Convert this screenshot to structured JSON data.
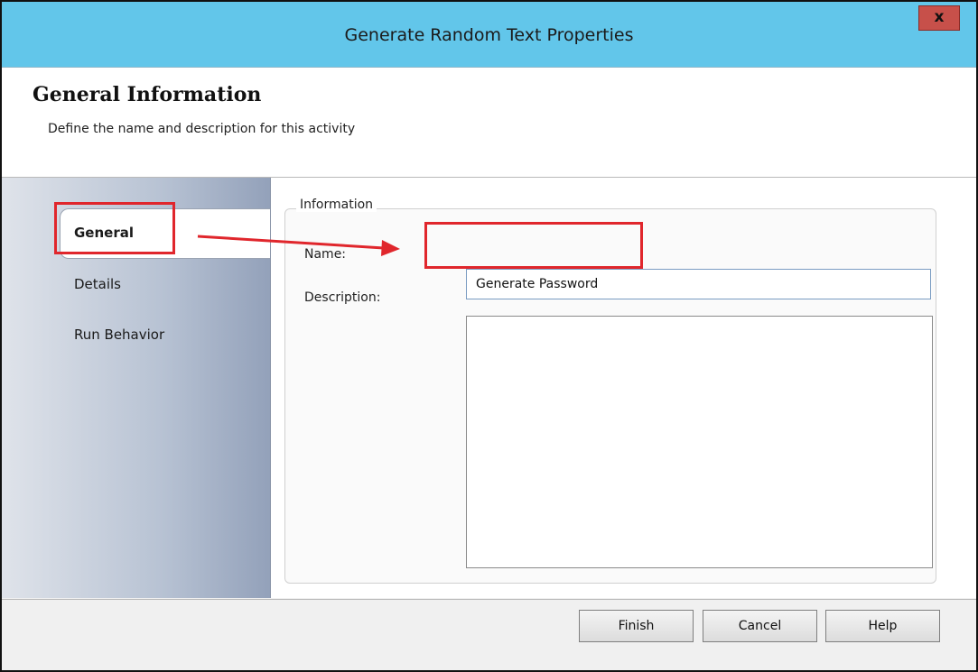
{
  "window": {
    "title": "Generate Random Text Properties",
    "close_label": "x",
    "titlebar_color": "#62c6ea",
    "close_color": "#c7504a"
  },
  "header": {
    "title": "General Information",
    "subtitle": "Define the name and description for this activity"
  },
  "nav": {
    "items": [
      {
        "label": "General",
        "active": true
      },
      {
        "label": "Details",
        "active": false
      },
      {
        "label": "Run Behavior",
        "active": false
      }
    ]
  },
  "form": {
    "group_label": "Information",
    "name_label": "Name:",
    "name_value": "Generate Password",
    "description_label": "Description:",
    "description_value": ""
  },
  "footer": {
    "finish_label": "Finish",
    "cancel_label": "Cancel",
    "help_label": "Help"
  },
  "annotations": {
    "highlight_color": "#e0262c"
  }
}
